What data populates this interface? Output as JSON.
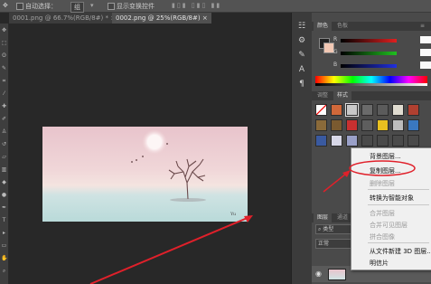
{
  "options_bar": {
    "auto_select_label": "自动选择：",
    "auto_select_value": "组",
    "show_transform_label": "显示变换控件"
  },
  "doc_tabs": [
    {
      "label": "0001.png @ 66.7%(RGB/8#) *",
      "close": "×"
    },
    {
      "label": "0002.png @ 25%(RGB/8#)",
      "close": "×"
    }
  ],
  "color_panel": {
    "tabs": [
      "颜色",
      "色板"
    ],
    "channels": [
      {
        "label": "R",
        "value": "0"
      },
      {
        "label": "G",
        "value": "0"
      },
      {
        "label": "B",
        "value": "0"
      }
    ]
  },
  "styles_panel": {
    "tabs": [
      "调整",
      "样式"
    ]
  },
  "layers_panel": {
    "tabs": [
      "图层",
      "通道"
    ],
    "filter_label": "类型",
    "mode_label": "正常"
  },
  "context_menu": {
    "items": [
      {
        "label": "背景图层...",
        "disabled": false
      },
      {
        "label": "复制图层...",
        "disabled": false
      },
      {
        "label": "删除图层",
        "disabled": true
      },
      {
        "label": "转换为智能对象",
        "disabled": false
      },
      {
        "label": "合并图层",
        "disabled": true
      },
      {
        "label": "合并可见图层",
        "disabled": true
      },
      {
        "label": "拼合图像",
        "disabled": true
      },
      {
        "label": "从文件新建 3D 图层...",
        "disabled": false
      },
      {
        "label": "明信片",
        "disabled": false
      }
    ]
  },
  "colors": {
    "annotation_red": "#e0202a",
    "foreground": "#222222",
    "background": "#f2c8b4"
  },
  "icons": [
    "move-tool-icon",
    "marquee-tool-icon",
    "lasso-tool-icon",
    "crop-tool-icon",
    "brush-tool-icon",
    "type-tool-icon",
    "layer-eye-icon"
  ]
}
